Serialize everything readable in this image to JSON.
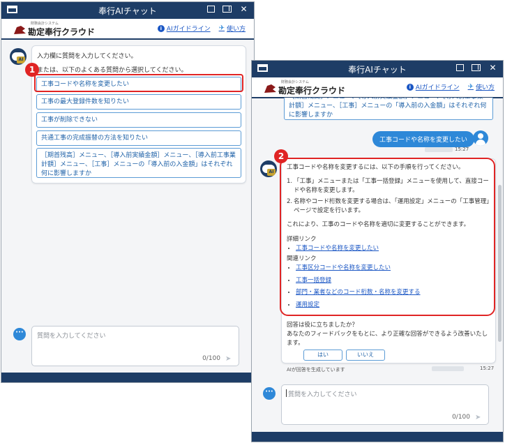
{
  "app": {
    "title": "奉行AIチャット",
    "logo_sub": "財務会計システム",
    "logo_badge": "i",
    "logo_main": "勘定奉行クラウド",
    "guideline_link": "AIガイドライン",
    "howto_link": "使い方"
  },
  "window1": {
    "greeting_line1": "入力欄に質問を入力してください。",
    "greeting_line2": "または、以下のよくある質問から選択してください。",
    "options": [
      "工事コードや名称を変更したい",
      "工事の最大登録件数を知りたい",
      "工事が削除できない",
      "共通工事の完成振替の方法を知りたい",
      "［期首残高］メニュー、［導入前実績金額］メニュー、［導入前工事業計額］メニュー、［工事］メニューの「導入前の入金額」はそれぞれ何に影響しますか"
    ],
    "badge": "1",
    "input_placeholder": "質問を入力してください",
    "char_count": "0/100"
  },
  "window2": {
    "prev_option_text": "［期首残高］メニュー、［導入前実績金額］メニュー、［導入前工事業計額］メニュー、［工事］メニューの「導入前の入金額」はそれぞれ何に影響しますか",
    "user_message": "工事コードや名称を変更したい",
    "user_time": "15:27",
    "badge": "2",
    "answer_intro": "工事コードや名称を変更するには、以下の手順を行ってください。",
    "steps": [
      "「工事」メニューまたは「工事一括登録」メニューを使用して、直接コードや名称を変更します。",
      "名称やコード桁数を変更する場合は、「運用設定」メニューの「工事管理」ページで設定を行います。"
    ],
    "answer_outro": "これにより、工事のコードや名称を適切に変更することができます。",
    "detail_heading": "詳細リンク",
    "detail_links": [
      "工事コードや名称を変更したい"
    ],
    "related_heading": "関連リンク",
    "related_links": [
      "工事区分コードや名称を変更したい",
      "工事一括登録",
      "部門・業者などのコード桁数・名称を変更する",
      "運用設定"
    ],
    "feedback_question": "回答は役に立ちましたか？",
    "feedback_note": "あなたのフィードバックをもとに、より正確な回答ができるよう改善いたします。",
    "yes_label": "はい",
    "no_label": "いいえ",
    "ai_disclaimer": "AIが回答を生成しています",
    "bot_time": "15:27",
    "input_placeholder": "質問を入力してください",
    "char_count": "0/100"
  },
  "colors": {
    "titlebar": "#1e3d66",
    "accent": "#2e88d8",
    "highlight": "#e02424",
    "link": "#1a56c4"
  }
}
